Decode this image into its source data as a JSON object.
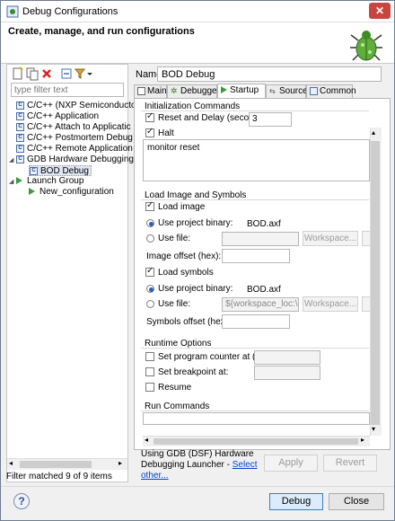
{
  "window": {
    "title": "Debug Configurations"
  },
  "header": {
    "title": "Create, manage, and run configurations"
  },
  "left": {
    "filter_placeholder": "type filter text",
    "tree": [
      {
        "label": "C/C++ (NXP Semiconducto",
        "icon": "c-config-icon"
      },
      {
        "label": "C/C++ Application",
        "icon": "c-config-icon"
      },
      {
        "label": "C/C++ Attach to Applicatic",
        "icon": "c-config-icon"
      },
      {
        "label": "C/C++ Postmortem Debug",
        "icon": "c-config-icon"
      },
      {
        "label": "C/C++ Remote Application",
        "icon": "c-config-icon"
      },
      {
        "label": "GDB Hardware Debugging",
        "icon": "c-config-icon"
      },
      {
        "label": "BOD Debug",
        "icon": "c-config-icon"
      },
      {
        "label": "Launch Group",
        "icon": "launch-icon"
      },
      {
        "label": "New_configuration",
        "icon": "launch-icon"
      }
    ],
    "filter_message": "Filter matched 9 of 9 items"
  },
  "main": {
    "name_label": "Name:",
    "name_value": "BOD Debug",
    "tabs": [
      {
        "label": "Main"
      },
      {
        "label": "Debugger"
      },
      {
        "label": "Startup"
      },
      {
        "label": "Source"
      },
      {
        "label": "Common"
      }
    ],
    "init": {
      "title": "Initialization Commands",
      "reset_label": "Reset and Delay (seconds):",
      "reset_value": "3",
      "halt_label": "Halt",
      "commands": "monitor reset"
    },
    "load": {
      "title": "Load Image and Symbols",
      "load_image_label": "Load image",
      "use_project_binary_label": "Use project binary:",
      "image_binary": "BOD.axf",
      "use_file_label": "Use file:",
      "workspace_button": "Workspace...",
      "image_offset_label": "Image offset (hex):",
      "load_symbols_label": "Load symbols",
      "symbols_binary": "BOD.axf",
      "symbols_file_value": "${workspace_loc:\\BOD\\",
      "symbols_offset_label": "Symbols offset (hex):"
    },
    "runtime": {
      "title": "Runtime Options",
      "set_pc_label": "Set program counter at (hex):",
      "set_bp_label": "Set breakpoint at:",
      "resume_label": "Resume"
    },
    "run_commands": {
      "title": "Run Commands"
    },
    "launcher_text": "Using GDB (DSF) Hardware Debugging Launcher - ",
    "launcher_link": "Select other...",
    "apply_button": "Apply",
    "revert_button": "Revert"
  },
  "footer": {
    "help": "?",
    "debug_button": "Debug",
    "close_button": "Close"
  }
}
